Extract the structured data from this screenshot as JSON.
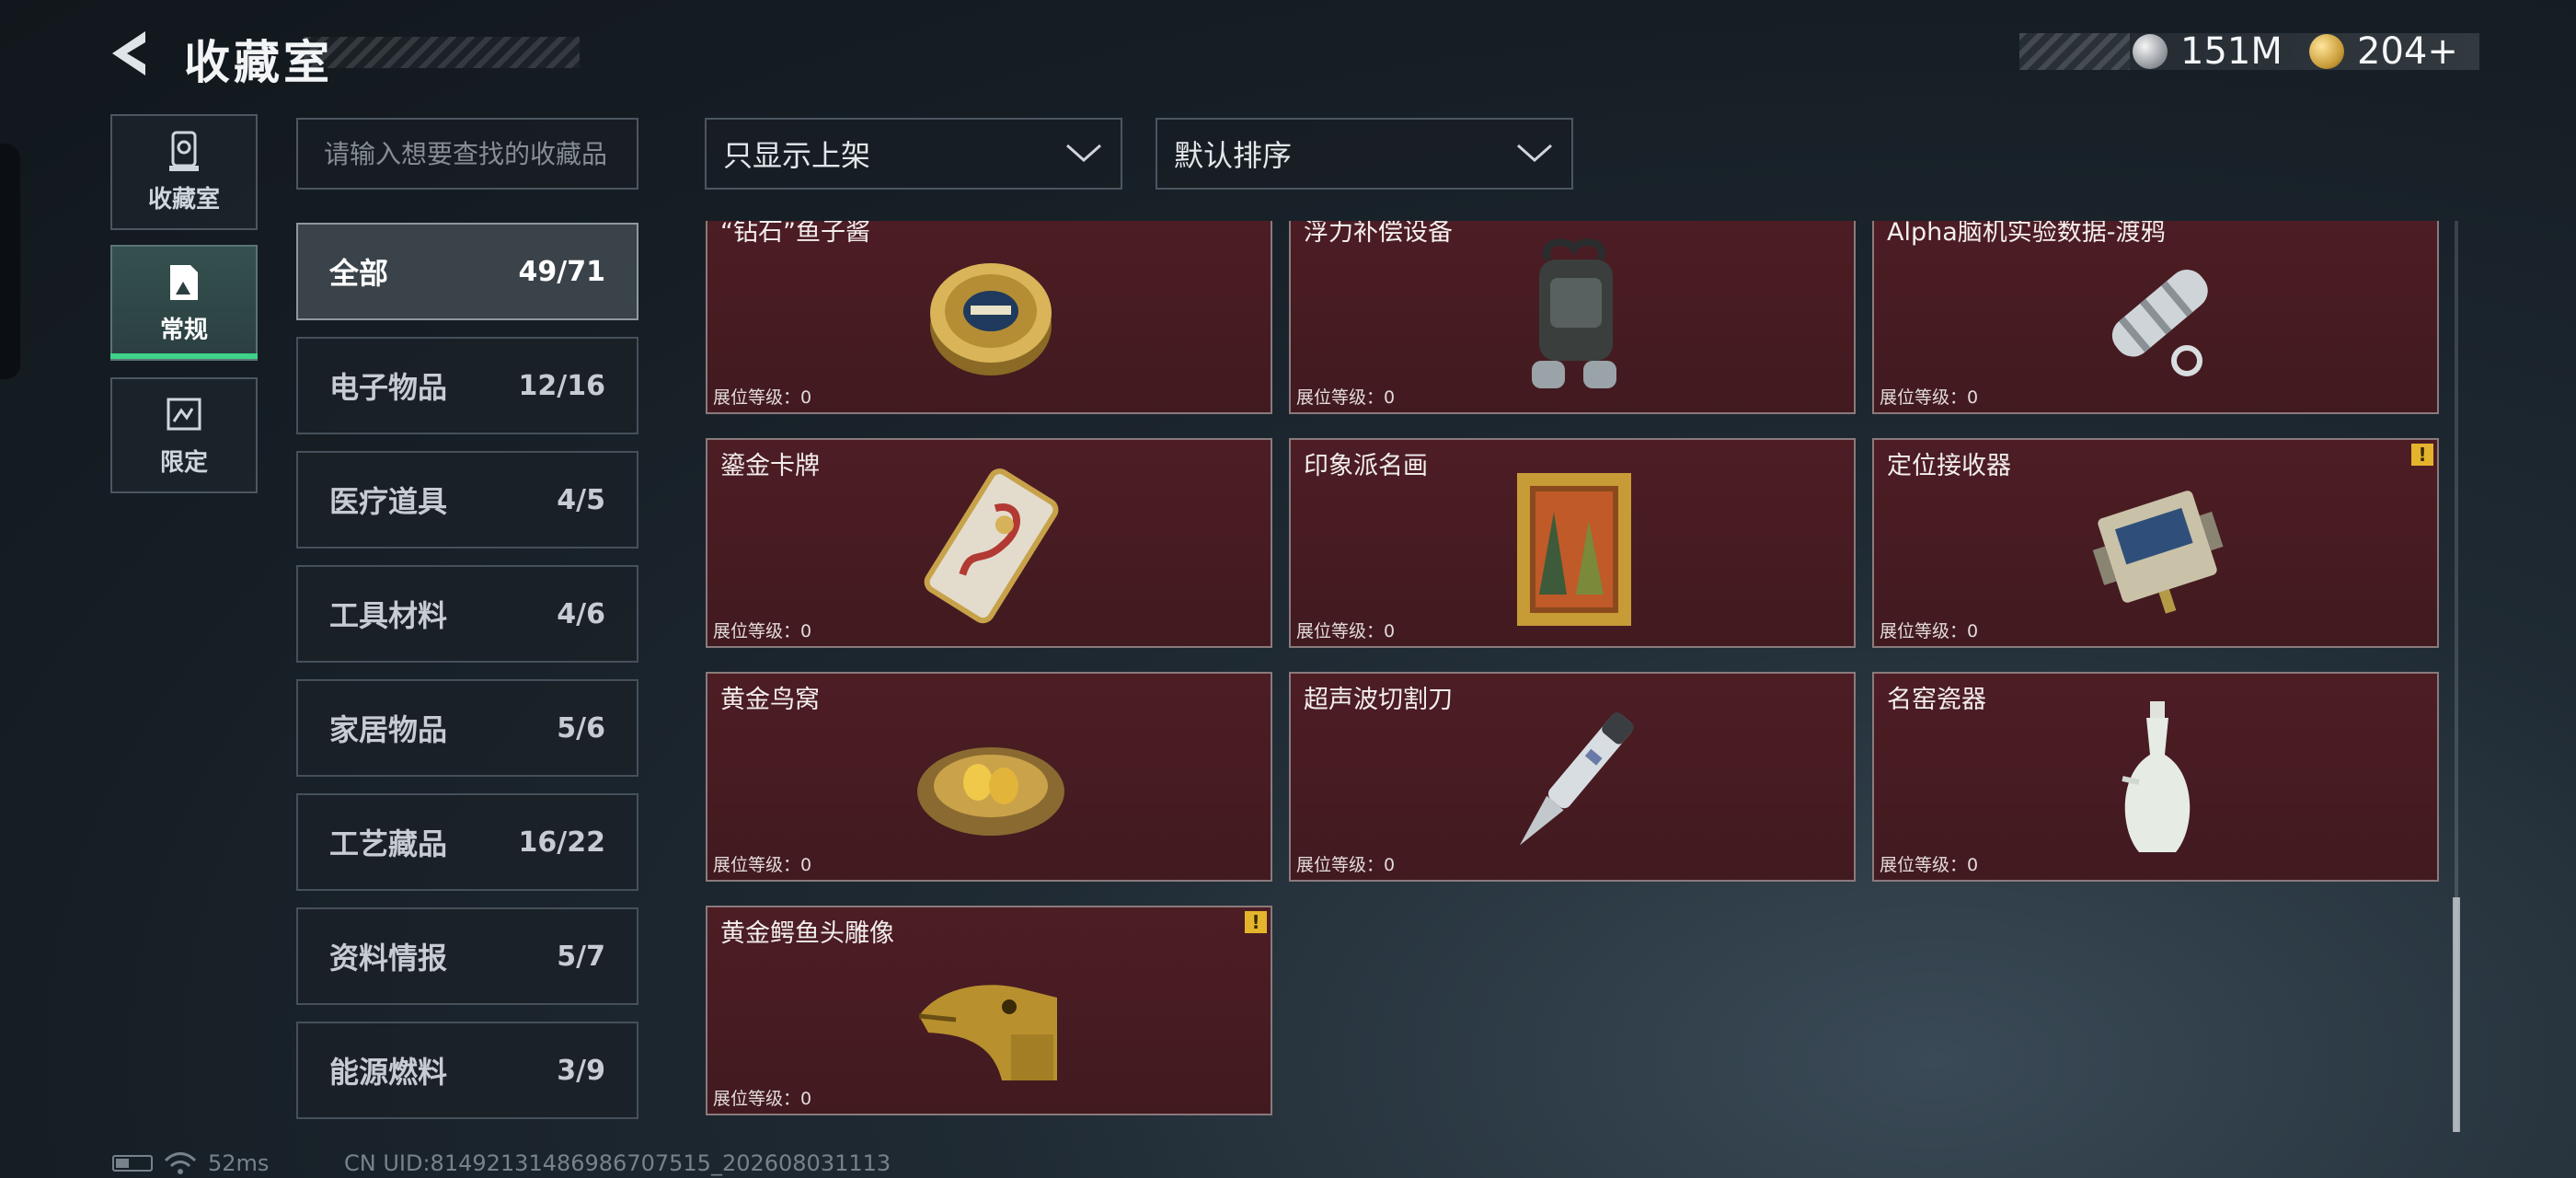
{
  "header": {
    "title": "收藏室",
    "currencies": [
      {
        "icon": "silver-coin-icon",
        "value": "151M"
      },
      {
        "icon": "gold-coin-icon",
        "value": "204+"
      }
    ]
  },
  "mode_tabs": [
    {
      "label": "收藏室",
      "icon": "collection-icon",
      "active": false
    },
    {
      "label": "常规",
      "icon": "picture-card-icon",
      "active": true
    },
    {
      "label": "限定",
      "icon": "limited-icon",
      "active": false
    }
  ],
  "search": {
    "placeholder": "请输入想要查找的收藏品",
    "value": ""
  },
  "filters": {
    "show_filter": "只显示上架",
    "sort": "默认排序"
  },
  "categories": [
    {
      "label": "全部",
      "count": "49/71",
      "active": true
    },
    {
      "label": "电子物品",
      "count": "12/16",
      "active": false
    },
    {
      "label": "医疗道具",
      "count": "4/5",
      "active": false
    },
    {
      "label": "工具材料",
      "count": "4/6",
      "active": false
    },
    {
      "label": "家居物品",
      "count": "5/6",
      "active": false
    },
    {
      "label": "工艺藏品",
      "count": "16/22",
      "active": false
    },
    {
      "label": "资料情报",
      "count": "5/7",
      "active": false
    },
    {
      "label": "能源燃料",
      "count": "3/9",
      "active": false
    }
  ],
  "items": [
    {
      "name": "“钻石”鱼子酱",
      "level": "展位等级：0",
      "icon": "caviar-tin-icon",
      "warning": false
    },
    {
      "name": "浮力补偿设备",
      "level": "展位等级：0",
      "icon": "buoyancy-device-icon",
      "warning": false
    },
    {
      "name": "Alpha脑机实验数据-渡鸦",
      "level": "展位等级：0",
      "icon": "data-capsule-icon",
      "warning": false
    },
    {
      "name": "鎏金卡牌",
      "level": "展位等级：0",
      "icon": "gilded-card-icon",
      "warning": false
    },
    {
      "name": "印象派名画",
      "level": "展位等级：0",
      "icon": "framed-painting-icon",
      "warning": false
    },
    {
      "name": "定位接收器",
      "level": "展位等级：0",
      "icon": "locator-receiver-icon",
      "warning": true
    },
    {
      "name": "黄金鸟窝",
      "level": "展位等级：0",
      "icon": "golden-nest-icon",
      "warning": false
    },
    {
      "name": "超声波切割刀",
      "level": "展位等级：0",
      "icon": "ultrasonic-cutter-icon",
      "warning": false
    },
    {
      "name": "名窑瓷器",
      "level": "展位等级：0",
      "icon": "porcelain-vase-icon",
      "warning": false
    },
    {
      "name": "黄金鳄鱼头雕像",
      "level": "展位等级：0",
      "icon": "gold-crocodile-head-icon",
      "warning": true
    }
  ],
  "footer": {
    "ping": "52ms",
    "uid": "CN UID:8149213148698670​7515_202608031113"
  }
}
